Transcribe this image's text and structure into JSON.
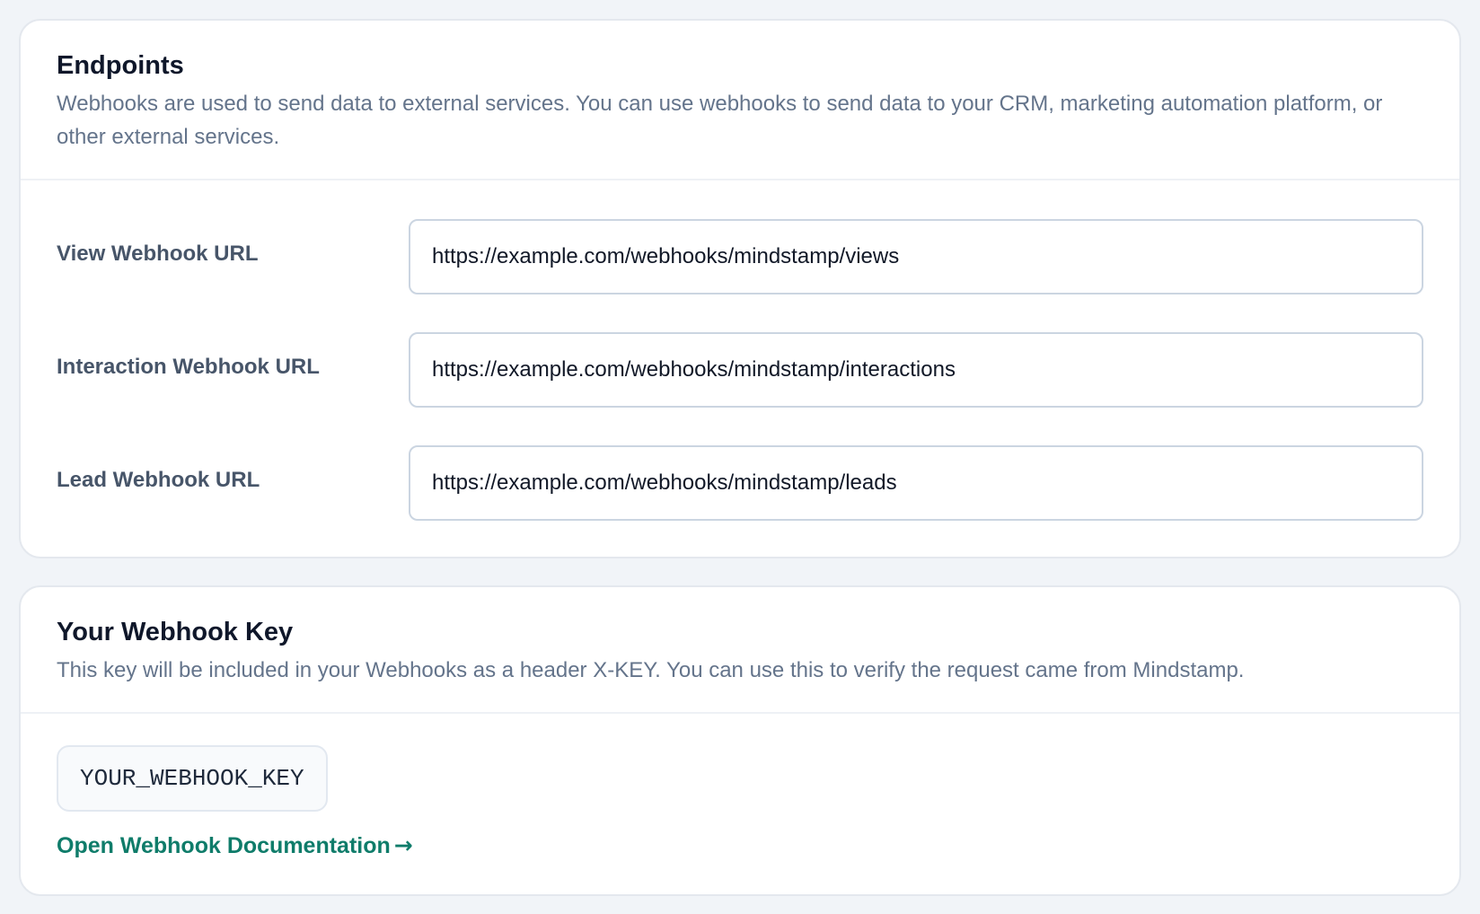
{
  "endpoints": {
    "title": "Endpoints",
    "description": "Webhooks are used to send data to external services. You can use webhooks to send data to your CRM, marketing automation platform, or other external services.",
    "fields": [
      {
        "label": "View Webhook URL",
        "value": "https://example.com/webhooks/mindstamp/views"
      },
      {
        "label": "Interaction Webhook URL",
        "value": "https://example.com/webhooks/mindstamp/interactions"
      },
      {
        "label": "Lead Webhook URL",
        "value": "https://example.com/webhooks/mindstamp/leads"
      }
    ]
  },
  "webhook_key": {
    "title": "Your Webhook Key",
    "description": "This key will be included in your Webhooks as a header X-KEY. You can use this to verify the request came from Mindstamp.",
    "key_value": "YOUR_WEBHOOK_KEY",
    "docs_link_label": "Open Webhook Documentation",
    "docs_link_icon": "arrow-right-icon",
    "docs_link_arrow": "→"
  },
  "colors": {
    "page_background": "#f1f4f8",
    "card_background": "#ffffff",
    "title": "#0f172a",
    "description": "#64748b",
    "label": "#475569",
    "link_accent": "#0f7c6a"
  }
}
